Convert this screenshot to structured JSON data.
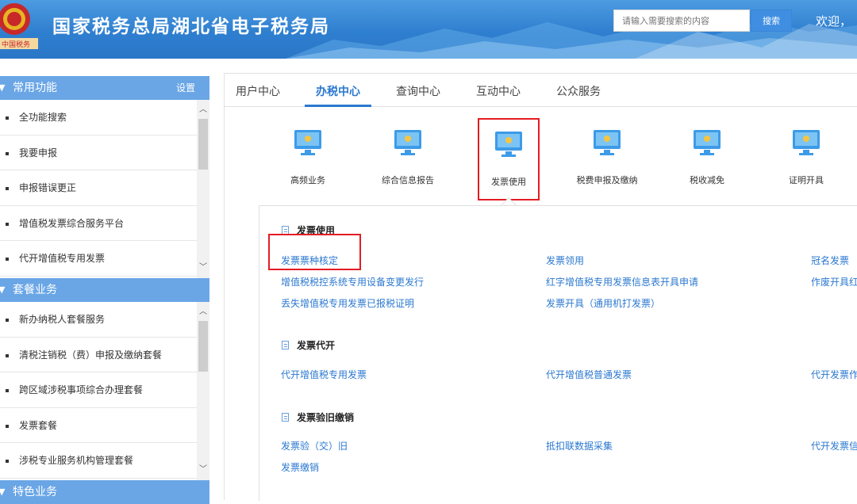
{
  "header": {
    "title": "国家税务总局湖北省电子税务局",
    "search_placeholder": "请输入需要搜索的内容",
    "search_button": "搜索",
    "welcome": "欢迎，"
  },
  "sidebar": {
    "groups": [
      {
        "title": "常用功能",
        "setting": "设置",
        "items": [
          "全功能搜索",
          "我要申报",
          "申报错误更正",
          "增值税发票综合服务平台",
          "代开增值税专用发票"
        ]
      },
      {
        "title": "套餐业务",
        "items": [
          "新办纳税人套餐服务",
          "清税注销税（费）申报及缴纳套餐",
          "跨区域涉税事项综合办理套餐",
          "发票套餐",
          "涉税专业服务机构管理套餐"
        ]
      },
      {
        "title": "特色业务"
      }
    ]
  },
  "tabs": [
    "用户中心",
    "办税中心",
    "查询中心",
    "互动中心",
    "公众服务"
  ],
  "active_tab": "办税中心",
  "categories": [
    "高频业务",
    "综合信息报告",
    "发票使用",
    "税费申报及缴纳",
    "税收减免",
    "证明开具"
  ],
  "selected_category": "发票使用",
  "sections": [
    {
      "title": "发票使用",
      "links": [
        [
          "发票票种核定",
          "发票领用",
          "冠名发票"
        ],
        [
          "增值税税控系统专用设备变更发行",
          "红字增值税专用发票信息表开具申请",
          "作废开具红"
        ],
        [
          "丢失增值税专用发票已报税证明",
          "发票开具（通用机打发票）",
          ""
        ]
      ]
    },
    {
      "title": "发票代开",
      "links": [
        [
          "代开增值税专用发票",
          "代开增值税普通发票",
          "代开发票作"
        ]
      ]
    },
    {
      "title": "发票验旧缴销",
      "links": [
        [
          "发票验（交）旧",
          "抵扣联数据采集",
          "代开发票信"
        ],
        [
          "发票缴销",
          "",
          ""
        ]
      ]
    }
  ],
  "colors": {
    "accent": "#2b78d0",
    "header_blue": "#2f7fd0",
    "highlight_red": "#e51c23",
    "sidebar_head": "#6aa6e6"
  }
}
